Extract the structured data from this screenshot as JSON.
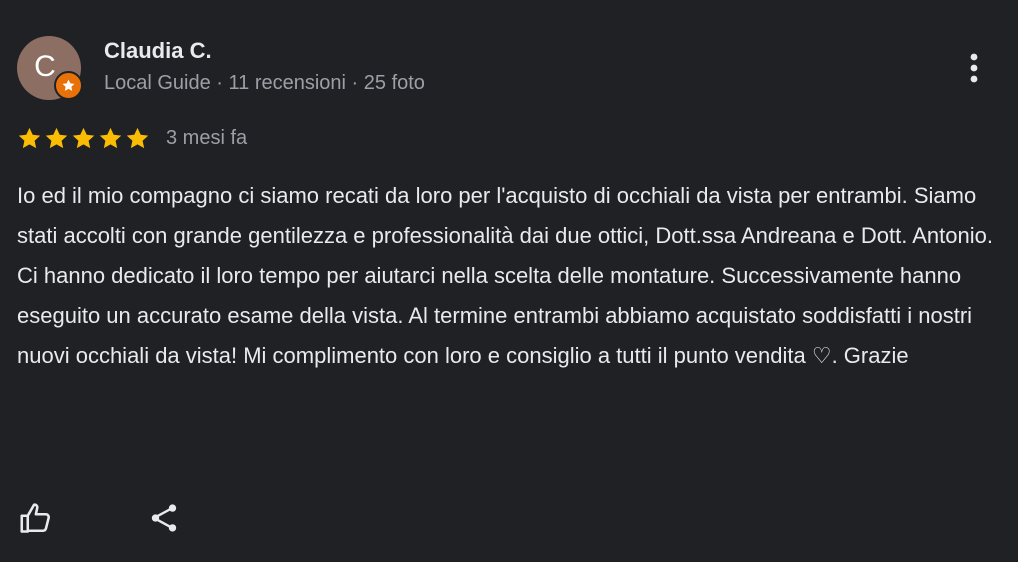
{
  "reviewer": {
    "avatar_letter": "C",
    "name": "Claudia C.",
    "meta": "Local Guide · 11 recensioni · 25 foto",
    "avatar_color": "#8d6e63",
    "badge_color": "#e8710a"
  },
  "rating": {
    "stars": 5,
    "max_stars": 5,
    "star_color": "#fbbc04",
    "date": "3 mesi fa"
  },
  "review": {
    "text": "Io ed il mio compagno ci siamo recati da loro per l'acquisto di occhiali da vista per entrambi. Siamo stati accolti con grande gentilezza e professionalità dai due ottici, Dott.ssa Andreana e Dott. Antonio. Ci hanno dedicato il loro tempo per aiutarci nella scelta delle montature. Successivamente hanno eseguito un accurato esame della vista. Al termine entrambi abbiamo acquistato soddisfatti i nostri nuovi occhiali da vista! Mi complimento con loro e consiglio a tutti il punto vendita ♡. Grazie"
  },
  "actions": {
    "like_icon": "thumbs-up-icon",
    "share_icon": "share-icon",
    "more_icon": "more-vert-icon"
  },
  "theme": {
    "background": "#202124",
    "text_primary": "#e8eaed",
    "text_secondary": "#9aa0a6"
  }
}
